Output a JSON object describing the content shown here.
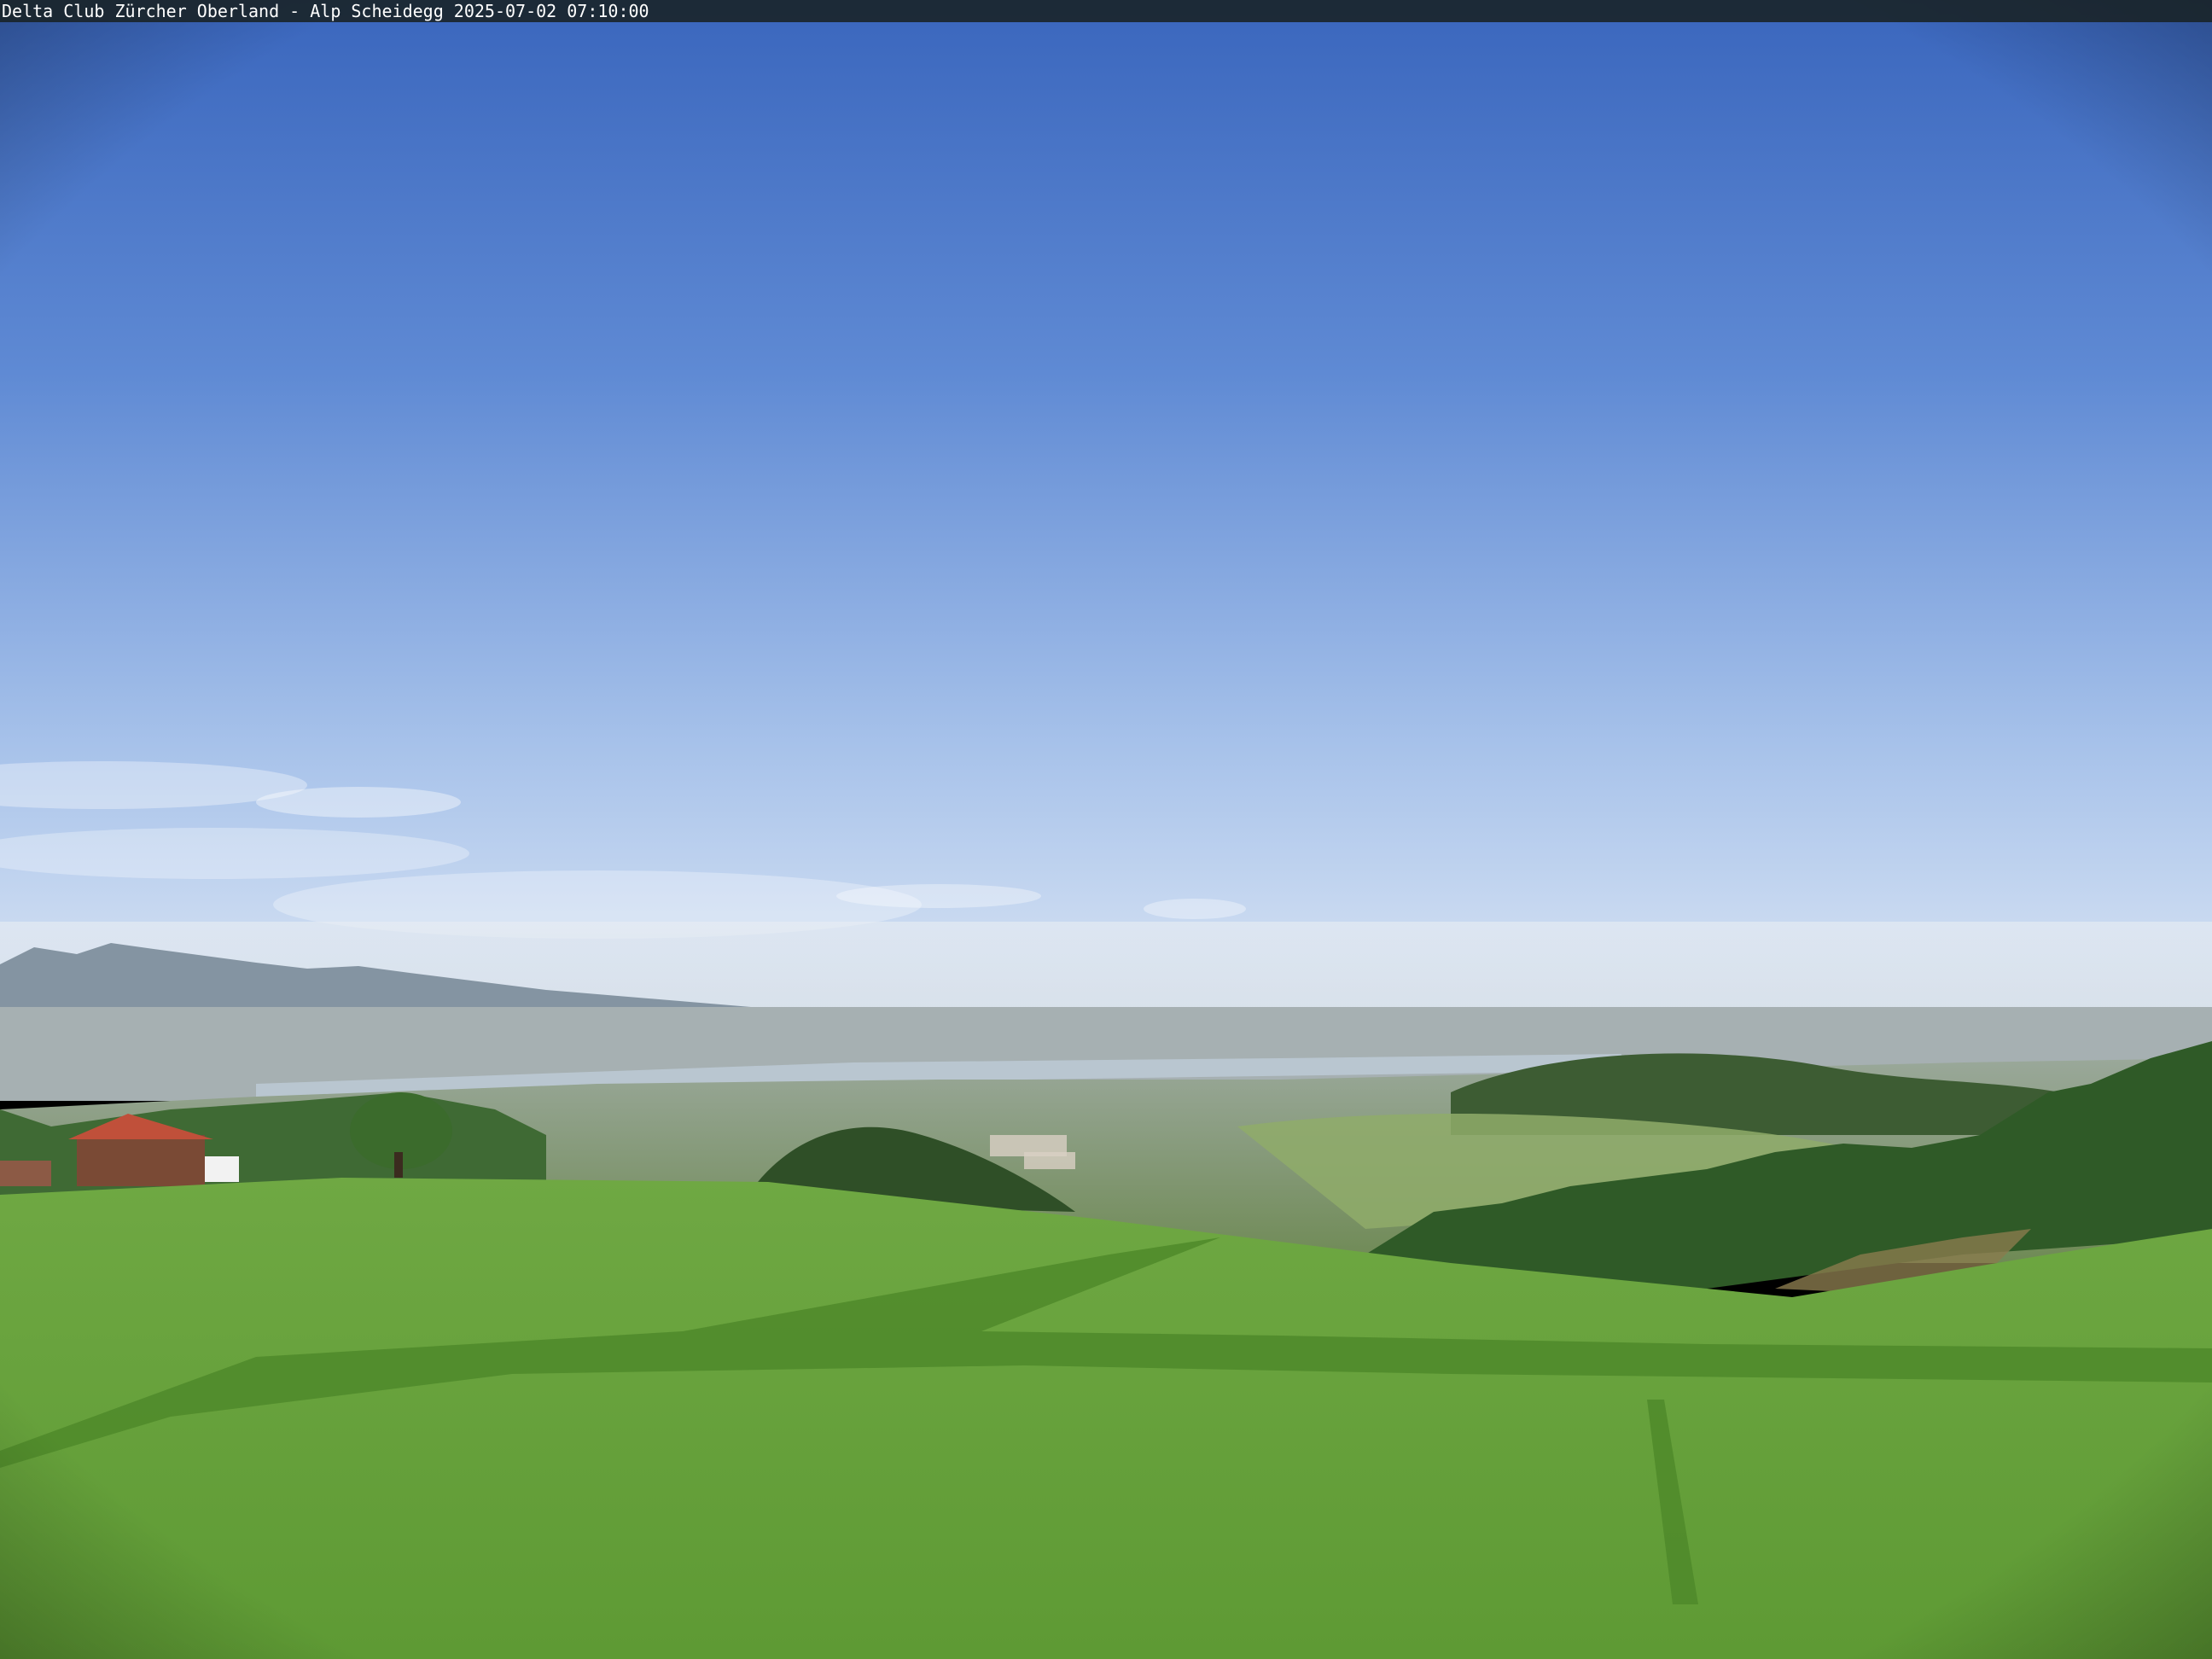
{
  "caption": {
    "text": "Delta Club Zürcher Oberland - Alp Scheidegg 2025-07-02 07:10:00"
  },
  "scene": {
    "elements": [
      "sky",
      "clouds",
      "alps",
      "lake",
      "valley",
      "forested-hills",
      "farmhouse",
      "trees",
      "meadow",
      "shadow"
    ],
    "colors": {
      "sky_top": "#3f6cc2",
      "sky_horizon": "#dde7f5",
      "meadow": "#6fa843",
      "meadow_dark": "#4f8a2a",
      "forest": "#2d5a25",
      "mountains": "#8a9aa8",
      "roof": "#c0503a"
    }
  }
}
